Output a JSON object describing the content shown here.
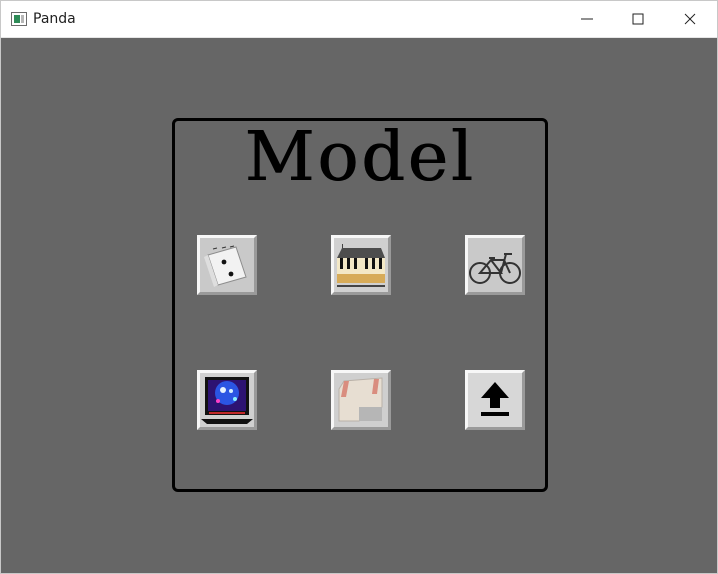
{
  "window": {
    "title": "Panda"
  },
  "panel": {
    "title": "Model"
  },
  "model_buttons": [
    {
      "icon": "dice-icon"
    },
    {
      "icon": "piano-icon"
    },
    {
      "icon": "bicycle-icon"
    },
    {
      "icon": "laptop-icon"
    },
    {
      "icon": "box-icon"
    },
    {
      "icon": "upload-icon"
    }
  ]
}
